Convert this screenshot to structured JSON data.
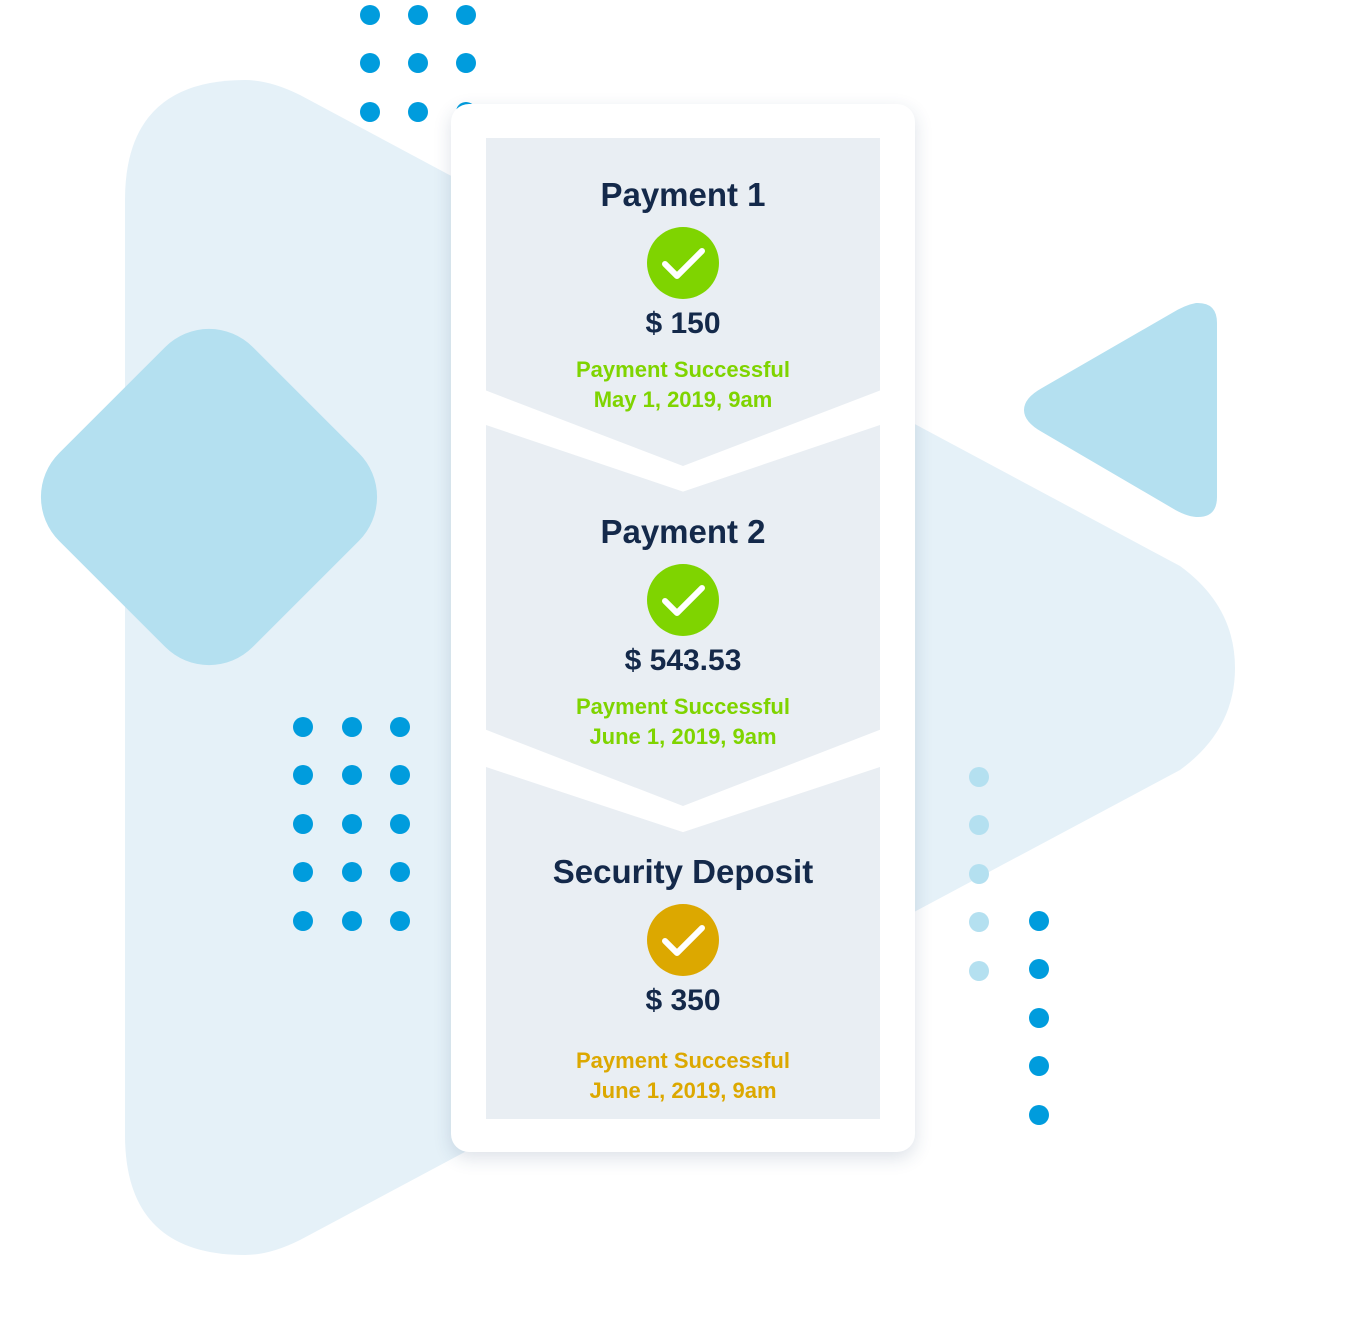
{
  "colors": {
    "success_green": "#7fd400",
    "deposit_gold": "#dca800",
    "heading_navy": "#14294a",
    "bg_shape_light": "#e5f1f8",
    "bg_shape_mid": "#b4e0f0",
    "dot_blue": "#009cdd",
    "dot_light": "#b4e0f0"
  },
  "payments": [
    {
      "title": "Payment 1",
      "icon": "check-circle-icon",
      "amount": "$ 150",
      "status": "Payment Successful",
      "date": "May 1, 2019, 9am",
      "color": "#7fd400"
    },
    {
      "title": "Payment 2",
      "icon": "check-circle-icon",
      "amount": "$ 543.53",
      "status": "Payment Successful",
      "date": "June 1, 2019, 9am",
      "color": "#7fd400"
    },
    {
      "title": "Security Deposit",
      "icon": "check-circle-icon",
      "amount": "$ 350",
      "status": "Payment Successful",
      "date": "June 1, 2019, 9am",
      "color": "#dca800"
    }
  ]
}
